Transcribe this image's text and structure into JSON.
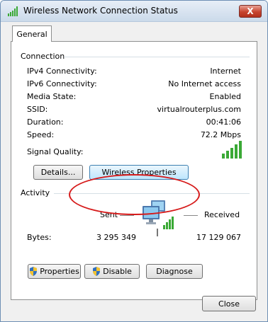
{
  "window": {
    "title": "Wireless Network Connection Status",
    "close_label": "X"
  },
  "tabs": [
    {
      "label": "General"
    }
  ],
  "connection": {
    "heading": "Connection",
    "rows": [
      {
        "label": "IPv4 Connectivity:",
        "value": "Internet"
      },
      {
        "label": "IPv6 Connectivity:",
        "value": "No Internet access"
      },
      {
        "label": "Media State:",
        "value": "Enabled"
      },
      {
        "label": "SSID:",
        "value": "virtualrouterplus.com"
      },
      {
        "label": "Duration:",
        "value": "00:41:06"
      },
      {
        "label": "Speed:",
        "value": "72.2 Mbps"
      }
    ],
    "signal_label": "Signal Quality:",
    "signal_bars": 5,
    "details_button": "Details...",
    "wireless_properties_button": "Wireless Properties"
  },
  "activity": {
    "heading": "Activity",
    "sent_label": "Sent",
    "received_label": "Received",
    "bytes_label": "Bytes:",
    "bytes_sent": "3 295 349",
    "bytes_received": "17 129 067"
  },
  "actions": {
    "properties": "Properties",
    "disable": "Disable",
    "diagnose": "Diagnose"
  },
  "footer": {
    "close": "Close"
  },
  "colors": {
    "signal": "#3aa935",
    "annotation": "#d61a1a",
    "focus": "#3c7fb1"
  }
}
